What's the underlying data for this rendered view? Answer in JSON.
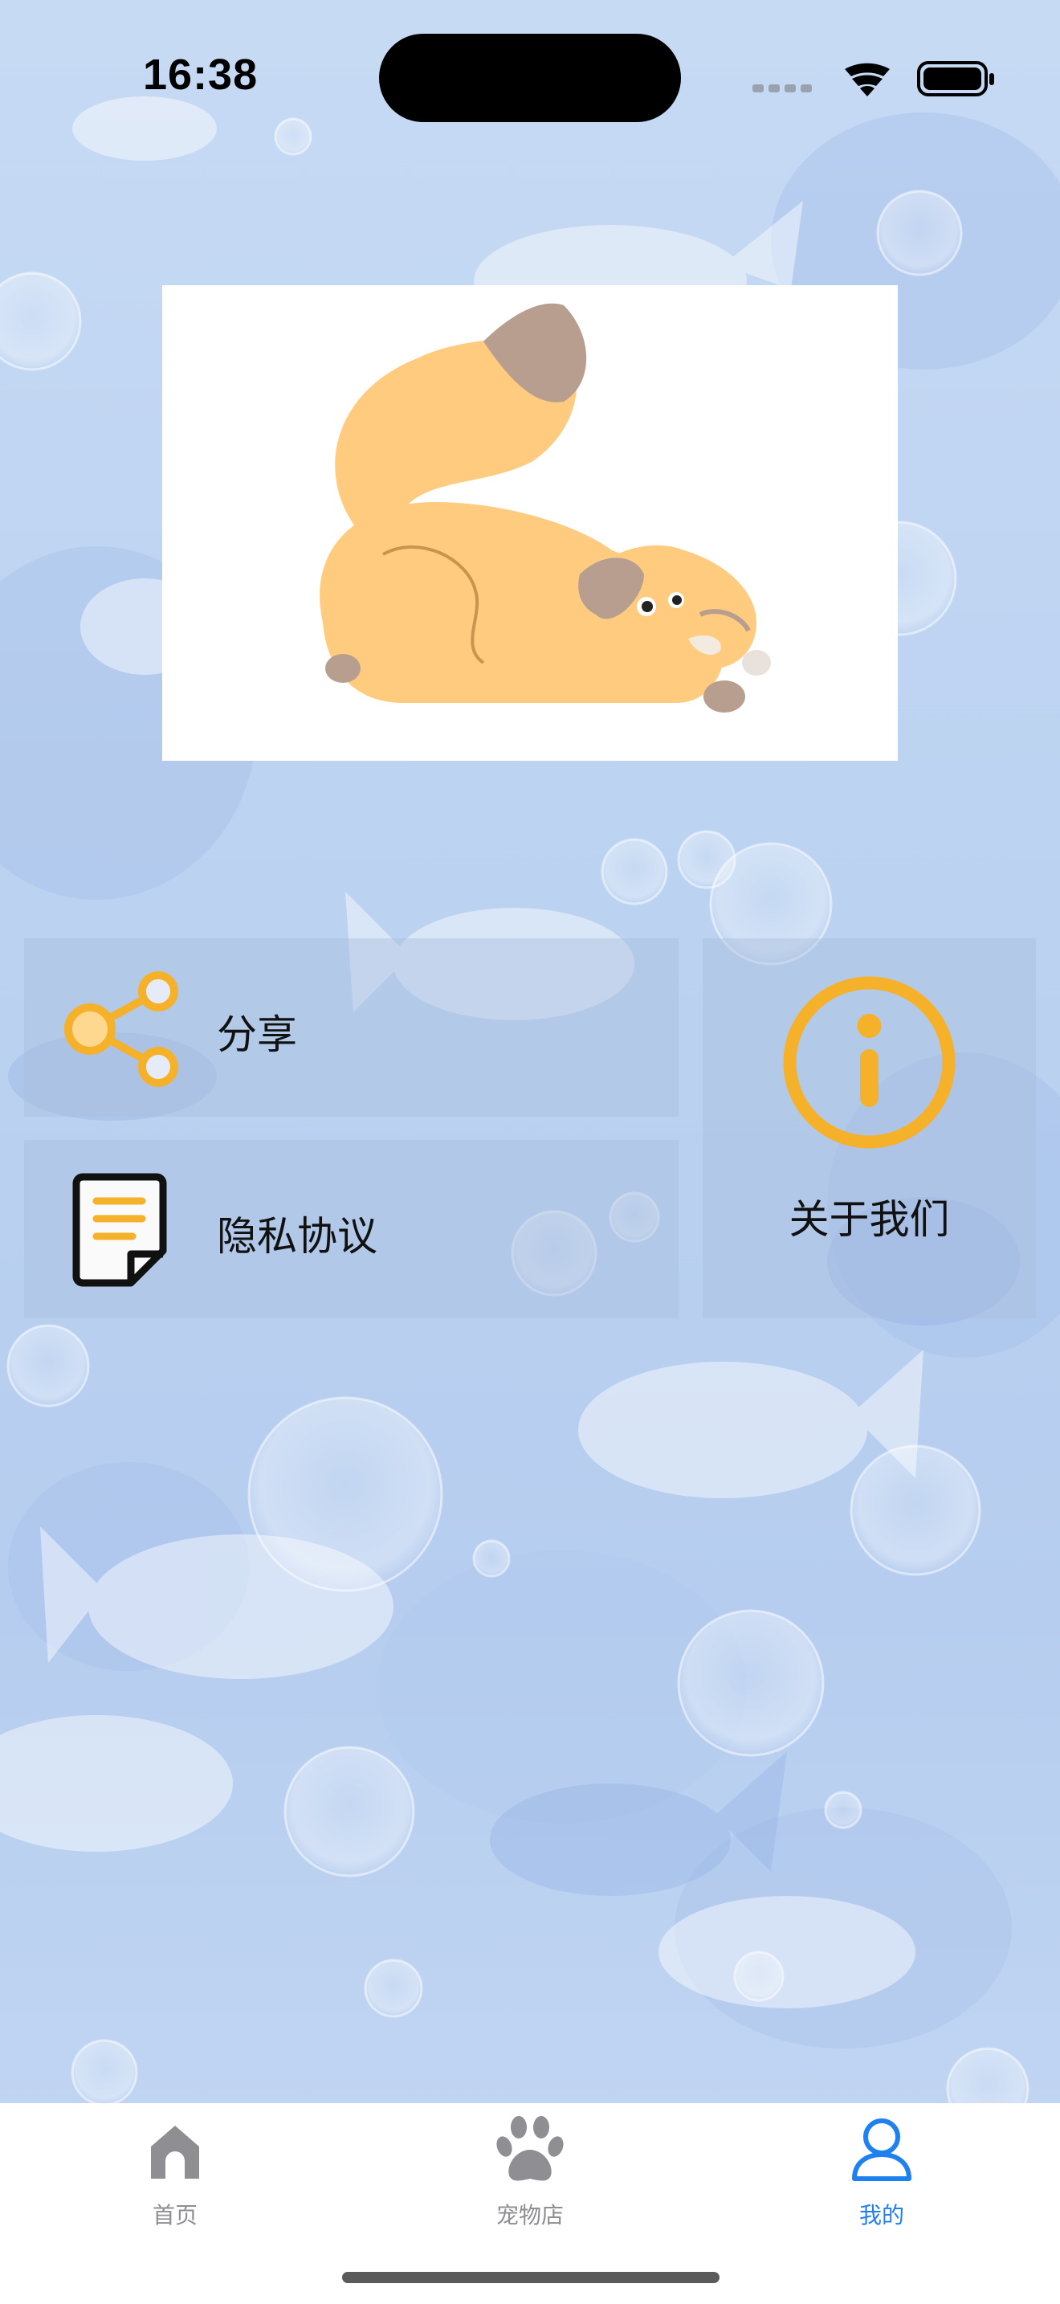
{
  "status_bar": {
    "time": "16:38"
  },
  "menu": {
    "share_label": "分享",
    "privacy_label": "隐私协议",
    "about_label": "关于我们"
  },
  "tabbar": {
    "items": [
      {
        "label": "首页",
        "icon": "house-icon",
        "active": false
      },
      {
        "label": "宠物店",
        "icon": "paw-icon",
        "active": false
      },
      {
        "label": "我的",
        "icon": "person-icon",
        "active": true
      }
    ]
  },
  "colors": {
    "accent_orange": "#f6b12b",
    "tab_active": "#1f80f0",
    "tab_inactive": "#8e8e93"
  }
}
